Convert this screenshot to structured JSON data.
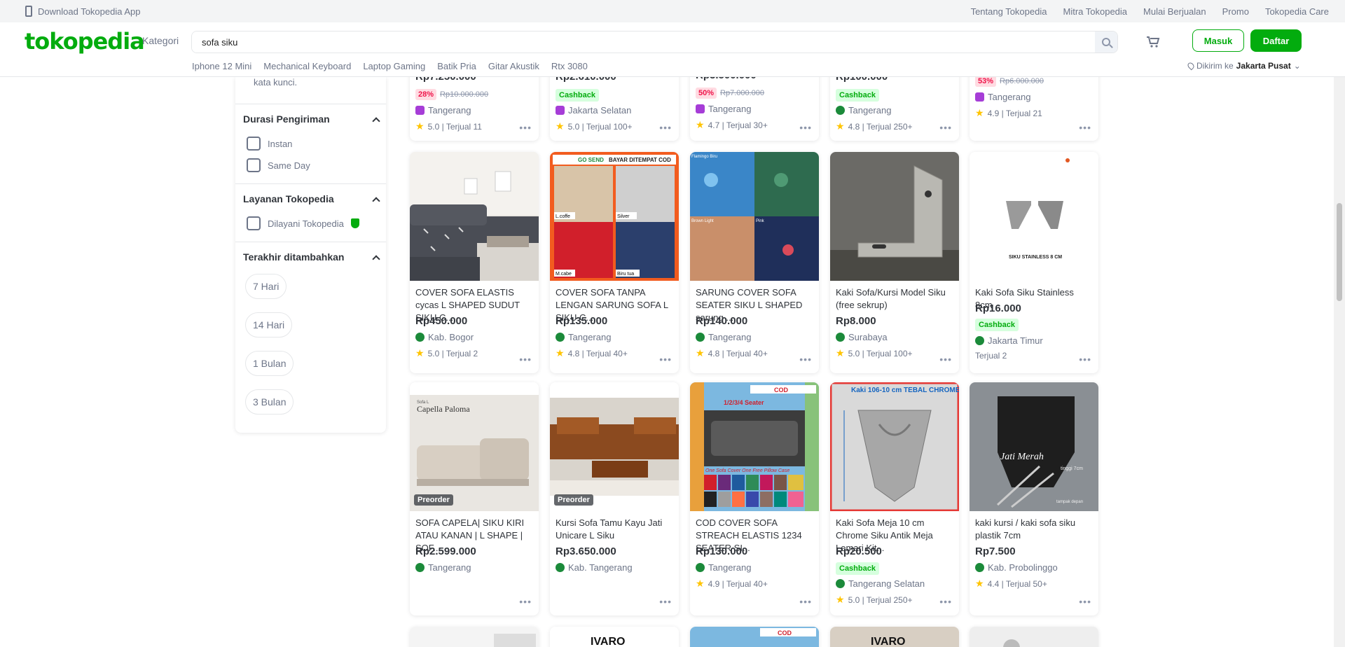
{
  "topbar": {
    "download_app": "Download Tokopedia App",
    "links": [
      "Tentang Tokopedia",
      "Mitra Tokopedia",
      "Mulai Berjualan",
      "Promo",
      "Tokopedia Care"
    ]
  },
  "header": {
    "logo": "tokopedia",
    "kategori": "Kategori",
    "search_value": "sofa siku",
    "masuk": "Masuk",
    "daftar": "Daftar",
    "quick_links": [
      "Iphone 12 Mini",
      "Mechanical Keyboard",
      "Laptop Gaming",
      "Batik Pria",
      "Gitar Akustik",
      "Rtx 3080"
    ],
    "location_prefix": "Dikirim ke",
    "location_value": "Jakarta Pusat"
  },
  "sidebar": {
    "truncated_text": "kata kunci.",
    "durasi_title": "Durasi Pengiriman",
    "durasi_options": [
      "Instan",
      "Same Day"
    ],
    "layanan_title": "Layanan Tokopedia",
    "layanan_options": [
      "Dilayani Tokopedia"
    ],
    "terakhir_title": "Terakhir ditambahkan",
    "terakhir_options": [
      "7 Hari",
      "14 Hari",
      "1 Bulan",
      "3 Bulan"
    ]
  },
  "row0": [
    {
      "price": "Rp7.250.000",
      "pct": "28%",
      "old": "Rp10.000.000",
      "shop": "Tangerang",
      "rating": "5.0 | Terjual 11"
    },
    {
      "price": "Rp2.610.000",
      "cashback": "Cashback",
      "shop": "Jakarta Selatan",
      "rating": "5.0 | Terjual 100+"
    },
    {
      "price": "Rp3.500.000",
      "pct": "50%",
      "old": "Rp7.000.000",
      "shop": "Tangerang",
      "rating": "4.7 | Terjual 30+"
    },
    {
      "price": "Rp100.000",
      "cashback": "Cashback",
      "shop": "Tangerang",
      "rating": "4.8 | Terjual 250+"
    },
    {
      "pct": "53%",
      "old": "Rp6.000.000",
      "shop": "Tangerang",
      "rating": "4.9 | Terjual 21"
    }
  ],
  "row1": [
    {
      "title": "COVER SOFA ELASTIS cycas L SHAPED SUDUT SIKU C...",
      "price": "Rp450.000",
      "shop": "Kab. Bogor",
      "rating": "5.0 | Terjual 2"
    },
    {
      "title": "COVER SOFA TANPA LENGAN SARUNG SOFA L SIKU C...",
      "price": "Rp135.000",
      "shop": "Tangerang",
      "rating": "4.8 | Terjual 40+"
    },
    {
      "title": "SARUNG COVER SOFA SEATER SIKU L SHAPED sarung ...",
      "price": "Rp140.000",
      "shop": "Tangerang",
      "rating": "4.8 | Terjual 40+"
    },
    {
      "title": "Kaki Sofa/Kursi Model Siku (free sekrup)",
      "price": "Rp8.000",
      "shop": "Surabaya",
      "rating": "5.0 | Terjual 100+"
    },
    {
      "title": "Kaki Sofa Siku Stainless 8cm",
      "price": "Rp16.000",
      "cashback": "Cashback",
      "shop": "Jakarta Timur",
      "rating": "Terjual 2"
    }
  ],
  "row2": [
    {
      "title": "SOFA CAPELA| SIKU KIRI ATAU KANAN | L SHAPE | SOF...",
      "price": "Rp2.599.000",
      "shop": "Tangerang",
      "preorder": "Preorder"
    },
    {
      "title": "Kursi Sofa Tamu Kayu Jati Unicare L Siku",
      "price": "Rp3.650.000",
      "shop": "Kab. Tangerang",
      "preorder": "Preorder"
    },
    {
      "title": "COD COVER SOFA STREACH ELASTIS 1234 SEATER SI...",
      "price": "Rp130.000",
      "shop": "Tangerang",
      "rating": "4.9 | Terjual 40+"
    },
    {
      "title": "Kaki Sofa Meja 10 cm Chrome Siku Antik Meja Lemari Kit...",
      "price": "Rp20.500",
      "cashback": "Cashback",
      "shop": "Tangerang Selatan",
      "rating": "5.0 | Terjual 250+"
    },
    {
      "title": "kaki kursi / kaki sofa siku plastik 7cm",
      "price": "Rp7.500",
      "shop": "Kab. Probolinggo",
      "rating": "4.4 | Terjual 50+"
    }
  ],
  "image_text": {
    "r1c1_top": "GO SEND",
    "r1c1_cod": "BAYAR DITEMPAT COD",
    "r1c1_q1": "L.coffe",
    "r1c1_q2": "Silver",
    "r1c1_q3": "M.cabe",
    "r1c1_q4": "Biru tua",
    "r1c2_q1": "Flamingo Biru",
    "r1c2_q3": "Brown Light",
    "r1c2_q4": "Pink",
    "r1c4_caption": "SIKU STAINLESS 8 CM",
    "r2c0_brand": "Capella Paloma",
    "r2c0_small": "Sofa L",
    "r2c2_cod": "COD",
    "r2c2_seater": "1/2/3/4 Seater",
    "r2c2_promo": "One Sofa Cover One Free Pillow Case",
    "r2c3_head": "Kaki 106-10 cm TEBAL CHROME",
    "r2c4_brand": "Jati Merah",
    "r2c4_size": "tinggi 7cm",
    "r2c4_view": "tampak depan",
    "r3_brand": "IVARO",
    "r3_cod": "COD"
  }
}
